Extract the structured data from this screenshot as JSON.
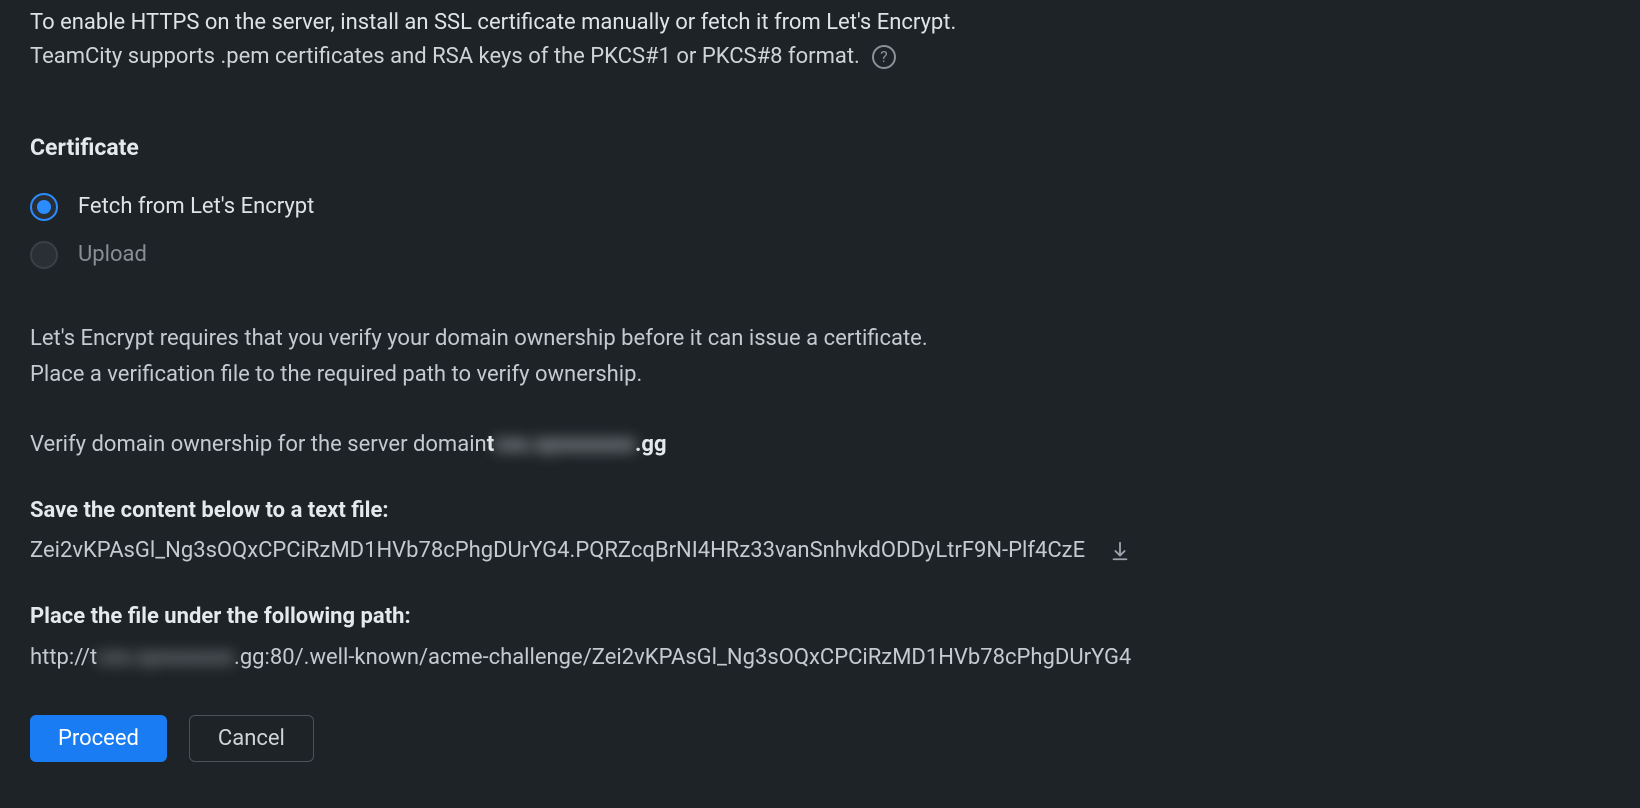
{
  "intro": {
    "line1": "To enable HTTPS on the server, install an SSL certificate manually or fetch it from Let's Encrypt.",
    "line2": "TeamCity supports .pem certificates and RSA keys of the PKCS#1 or PKCS#8 format."
  },
  "help_label": "?",
  "sections": {
    "certificate_heading": "Certificate"
  },
  "radio": {
    "fetch_label": "Fetch from Let's Encrypt",
    "upload_label": "Upload",
    "selected": "fetch"
  },
  "lets_encrypt": {
    "note1": "Let's Encrypt requires that you verify your domain ownership before it can issue a certificate.",
    "note2": "Place a verification file to the required path to verify ownership.",
    "verify_prefix": "Verify domain ownership for the server domain ",
    "domain_start": "t",
    "domain_hidden": "cxx.xyxxxxxxx",
    "domain_end": ".gg",
    "save_heading": "Save the content below to a text file:",
    "challenge_content": "Zei2vKPAsGl_Ng3sOQxCPCiRzMD1HVb78cPhgDUrYG4.PQRZcqBrNI4HRz33vanSnhvkdODDyLtrF9N-Plf4CzE",
    "path_heading": "Place the file under the following path:",
    "path_prefix": "http://t",
    "path_hidden": "cxx.xyxxxxxxx",
    "path_suffix": ".gg:80/.well-known/acme-challenge/Zei2vKPAsGl_Ng3sOQxCPCiRzMD1HVb78cPhgDUrYG4"
  },
  "buttons": {
    "proceed": "Proceed",
    "cancel": "Cancel"
  }
}
